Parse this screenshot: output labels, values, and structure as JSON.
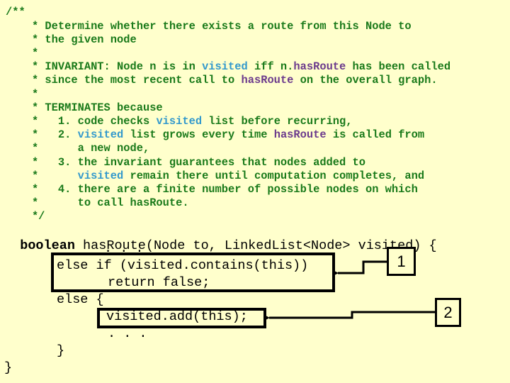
{
  "comment": {
    "lines": [
      [
        {
          "t": "/**"
        }
      ],
      [
        {
          "t": "    * Determine whether there exists a route from this Node to"
        }
      ],
      [
        {
          "t": "    * the given node"
        }
      ],
      [
        {
          "t": "    *"
        }
      ],
      [
        {
          "t": "    * INVARIANT: Node n is in "
        },
        {
          "t": "visited",
          "c": "visited"
        },
        {
          "t": " iff n."
        },
        {
          "t": "hasRoute",
          "c": "hasroute"
        },
        {
          "t": " has been called"
        }
      ],
      [
        {
          "t": "    * since the most recent call to "
        },
        {
          "t": "hasRoute",
          "c": "hasroute"
        },
        {
          "t": " on the overall graph."
        }
      ],
      [
        {
          "t": "    *"
        }
      ],
      [
        {
          "t": "    * TERMINATES because"
        }
      ],
      [
        {
          "t": "    *   1. code checks "
        },
        {
          "t": "visited",
          "c": "visited"
        },
        {
          "t": " list before recurring,"
        }
      ],
      [
        {
          "t": "    *   2. "
        },
        {
          "t": "visited",
          "c": "visited"
        },
        {
          "t": " list grows every time "
        },
        {
          "t": "hasRoute",
          "c": "hasroute"
        },
        {
          "t": " is called from"
        }
      ],
      [
        {
          "t": "    *      a new node,"
        }
      ],
      [
        {
          "t": "    *   3. the invariant guarantees that nodes added to"
        }
      ],
      [
        {
          "t": "    *      "
        },
        {
          "t": "visited",
          "c": "visited"
        },
        {
          "t": " remain there until computation completes, and"
        }
      ],
      [
        {
          "t": "    *   4. there are a finite number of possible nodes on which"
        }
      ],
      [
        {
          "t": "    *      to call hasRoute."
        }
      ],
      [
        {
          "t": "    */"
        }
      ]
    ]
  },
  "code": {
    "signature_keyword": "boolean",
    "signature_rest": " hasRoute(Node to, LinkedList<Node> visited) {",
    "ellipsis_1": ". . .",
    "else_if_line": "else if (visited.contains(this))",
    "return_line": "return false;",
    "else_line": "else {",
    "add_line": "visited.add(this);",
    "ellipsis_2": ". . .",
    "inner_close": "}",
    "outer_close": "}"
  },
  "callouts": {
    "one": "1",
    "two": "2"
  },
  "colors": {
    "background": "#ffffcc",
    "comment": "#1a7a1a",
    "visited_highlight": "#3399cc",
    "hasroute_highlight": "#6b3a8c",
    "code": "#000000"
  }
}
